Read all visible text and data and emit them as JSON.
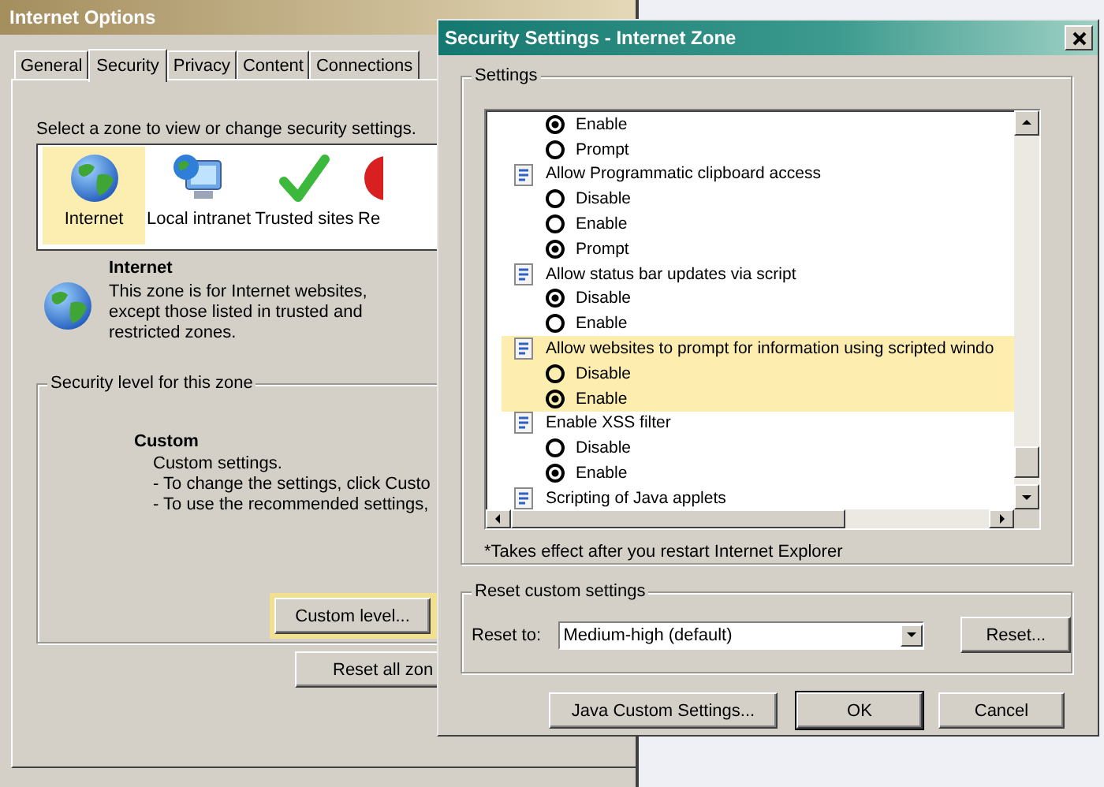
{
  "background_window": {
    "title": "Internet Options",
    "tabs": [
      {
        "label": "General",
        "selected": false
      },
      {
        "label": "Security",
        "selected": true
      },
      {
        "label": "Privacy",
        "selected": false
      },
      {
        "label": "Content",
        "selected": false
      },
      {
        "label": "Connections",
        "selected": false
      }
    ],
    "zone_prompt": "Select a zone to view or change security settings.",
    "zones": [
      {
        "label": "Internet",
        "kind": "globe",
        "selected": true
      },
      {
        "label": "Local intranet",
        "kind": "intranet",
        "selected": false
      },
      {
        "label": "Trusted sites",
        "kind": "trusted",
        "selected": false
      },
      {
        "label": "Re",
        "kind": "restricted",
        "selected": false
      }
    ],
    "zone_info": {
      "name": "Internet",
      "lines": [
        "This zone is for Internet websites,",
        "except those listed in trusted and",
        "restricted zones."
      ]
    },
    "security_level": {
      "legend": "Security level for this zone",
      "level_name": "Custom",
      "lines": [
        "Custom settings.",
        "- To change the settings, click Custo",
        "- To use the recommended settings,"
      ],
      "custom_level_button": {
        "label": "Custom level...",
        "highlighted": true
      },
      "reset_all_button": "Reset all zon"
    }
  },
  "dialog": {
    "title": "Security Settings - Internet Zone",
    "settings_legend": "Settings",
    "settings": [
      {
        "highlighted": false,
        "options": [
          {
            "label": "Enable",
            "selected": true
          },
          {
            "label": "Prompt",
            "selected": false
          }
        ]
      },
      {
        "title": "Allow Programmatic clipboard access",
        "highlighted": false,
        "options": [
          {
            "label": "Disable",
            "selected": false
          },
          {
            "label": "Enable",
            "selected": false
          },
          {
            "label": "Prompt",
            "selected": true
          }
        ]
      },
      {
        "title": "Allow status bar updates via script",
        "highlighted": false,
        "options": [
          {
            "label": "Disable",
            "selected": true
          },
          {
            "label": "Enable",
            "selected": false
          }
        ]
      },
      {
        "title": "Allow websites to prompt for information using scripted windo",
        "highlighted": true,
        "options": [
          {
            "label": "Disable",
            "selected": false
          },
          {
            "label": "Enable",
            "selected": true
          }
        ]
      },
      {
        "title": "Enable XSS filter",
        "highlighted": false,
        "options": [
          {
            "label": "Disable",
            "selected": false
          },
          {
            "label": "Enable",
            "selected": true
          }
        ]
      },
      {
        "title": "Scripting of Java applets",
        "highlighted": false
      }
    ],
    "footnote": "*Takes effect after you restart Internet Explorer",
    "reset": {
      "legend": "Reset custom settings",
      "label": "Reset to:",
      "value": "Medium-high (default)",
      "button": "Reset..."
    },
    "buttons": [
      {
        "label": "Java Custom Settings...",
        "default": false
      },
      {
        "label": "OK",
        "default": true
      },
      {
        "label": "Cancel",
        "default": false
      }
    ]
  }
}
